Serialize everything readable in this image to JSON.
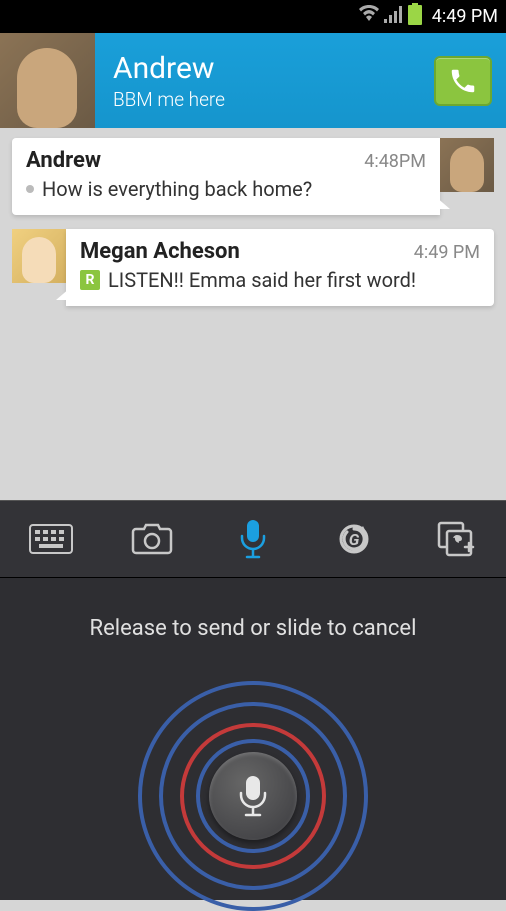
{
  "status": {
    "time": "4:49 PM"
  },
  "header": {
    "name": "Andrew",
    "sub": "BBM me here"
  },
  "messages": [
    {
      "sender": "Andrew",
      "time": "4:48PM",
      "text": "How is everything back home?"
    },
    {
      "sender": "Megan Acheson",
      "time": "4:49 PM",
      "text": "LISTEN!! Emma said her first word!"
    }
  ],
  "voice": {
    "hint": "Release to send or slide to cancel"
  }
}
